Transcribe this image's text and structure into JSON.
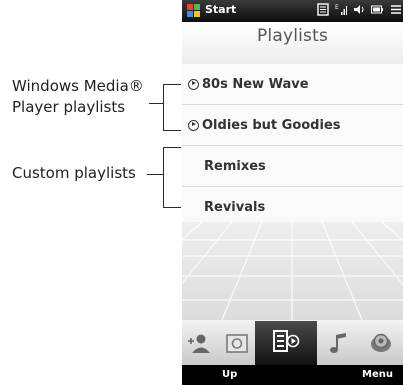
{
  "annotations": {
    "wmp_line1": "Windows Media®",
    "wmp_line2": "Player playlists",
    "custom": "Custom playlists"
  },
  "statusbar": {
    "start_label": "Start"
  },
  "header": {
    "title": "Playlists"
  },
  "playlists": [
    {
      "name": "80s New Wave",
      "type": "windows_media"
    },
    {
      "name": "Oldies but Goodies",
      "type": "windows_media"
    },
    {
      "name": "Remixes",
      "type": "custom"
    },
    {
      "name": "Revivals",
      "type": "custom"
    }
  ],
  "tabs": [
    {
      "icon": "people-icon",
      "active": false
    },
    {
      "icon": "photo-icon",
      "active": false
    },
    {
      "icon": "playlists-icon",
      "active": true
    },
    {
      "icon": "music-note-icon",
      "active": false
    },
    {
      "icon": "globe-icon",
      "active": false
    }
  ],
  "softkeys": {
    "left": "Up",
    "right": "Menu"
  }
}
